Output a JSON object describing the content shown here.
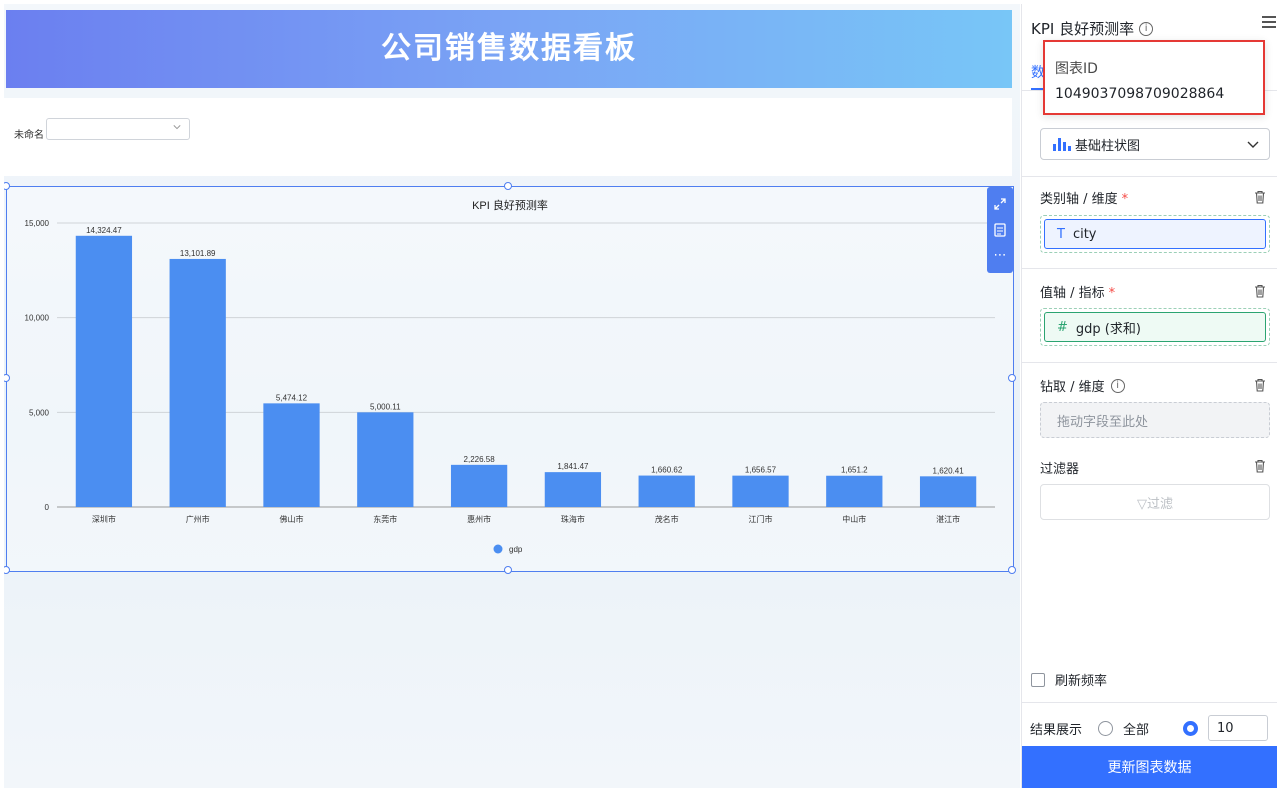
{
  "dashboard": {
    "title": "公司销售数据看板",
    "filter": {
      "label": "未命名",
      "value": ""
    }
  },
  "widget": {
    "tool_icons": [
      "expand-icon",
      "document-icon",
      "more-icon"
    ]
  },
  "chart_data": {
    "type": "bar",
    "title": "KPI 良好预测率",
    "categories": [
      "深圳市",
      "广州市",
      "佛山市",
      "东莞市",
      "惠州市",
      "珠海市",
      "茂名市",
      "江门市",
      "中山市",
      "湛江市"
    ],
    "series": [
      {
        "name": "gdp",
        "values": [
          14324.47,
          13101.89,
          5474.12,
          5000.11,
          2226.58,
          1841.47,
          1660.62,
          1656.57,
          1651.2,
          1620.41
        ]
      }
    ],
    "data_labels": [
      "14,324.47",
      "13,101.89",
      "5,474.12",
      "5,000.11",
      "2,226.58",
      "1,841.47",
      "1,660.62",
      "1,656.57",
      "1,651.2",
      "1,620.41"
    ],
    "yticks": [
      "0",
      "5,000",
      "10,000",
      "15,000"
    ],
    "ytick_values": [
      0,
      5000,
      10000,
      15000
    ],
    "ylim": [
      0,
      15000
    ],
    "grid": true,
    "legend": "bottom-center",
    "bar_color": "#4b8ef1"
  },
  "panel": {
    "title": "KPI 良好预测率",
    "tab_data": "数",
    "tooltip": {
      "label": "图表ID",
      "value": "1049037098709028864"
    },
    "chart_type": "基础柱状图",
    "dimension": {
      "label": "类别轴 / 维度",
      "required": "*",
      "field": "city",
      "field_icon": "T"
    },
    "metric": {
      "label": "值轴 / 指标",
      "required": "*",
      "field": "gdp (求和)",
      "field_icon": "#"
    },
    "drill": {
      "label": "钻取 / 维度",
      "placeholder": "拖动字段至此处"
    },
    "filter": {
      "label": "过滤器",
      "button": "▽过滤"
    },
    "refresh": {
      "label": "刷新频率"
    },
    "result": {
      "label": "结果展示",
      "option_all": "全部",
      "limit": "10"
    },
    "update_button": "更新图表数据"
  },
  "colors": {
    "accent": "#3370ff",
    "bar": "#4b8ef1",
    "required": "#f54a45",
    "highlight_border": "#e53935"
  }
}
